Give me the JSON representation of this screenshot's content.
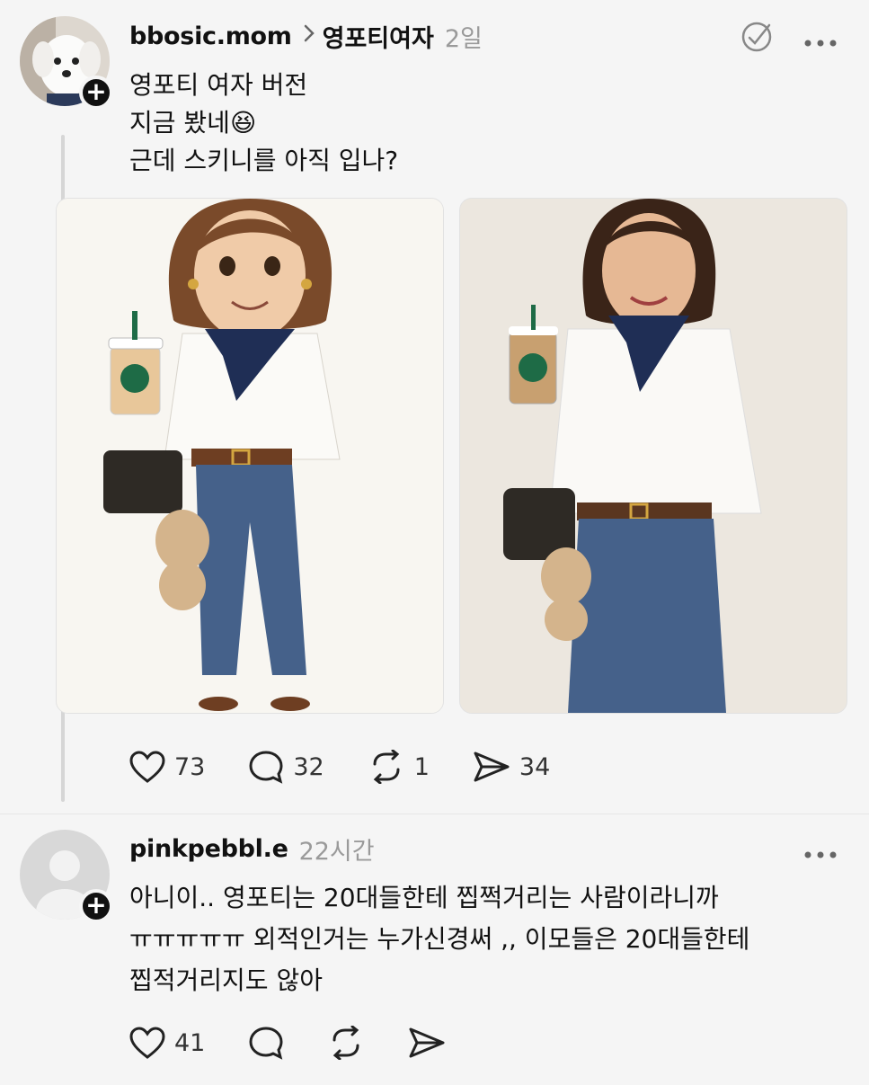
{
  "post": {
    "username": "bbosic.mom",
    "topic": "영포티여자",
    "time": "2일",
    "lines": [
      "영포티 여자 버전",
      "지금 봤네😆",
      "근데 스키니를 아직 입나?"
    ],
    "stats": {
      "likes": "73",
      "comments": "32",
      "reposts": "1",
      "shares": "34"
    },
    "icons": [
      "heart-icon",
      "comment-icon",
      "repost-icon",
      "share-icon",
      "more-icon"
    ]
  },
  "reply": {
    "username": "pinkpebbl.e",
    "time": "22시간",
    "lines": [
      "아니이.. 영포티는 20대들한테 찝쩍거리는 사람이라니까",
      "ㅠㅠㅠㅠㅠ 외적인거는 누가신경써 ,, 이모들은 20대들한테",
      "찝적거리지도 않아"
    ],
    "stats": {
      "likes": "41"
    }
  },
  "colors": {
    "scarf": "#1f2e55",
    "jeans": "#45618a",
    "hair": "#7a4a2a",
    "starbucks": "#1e6b46"
  }
}
